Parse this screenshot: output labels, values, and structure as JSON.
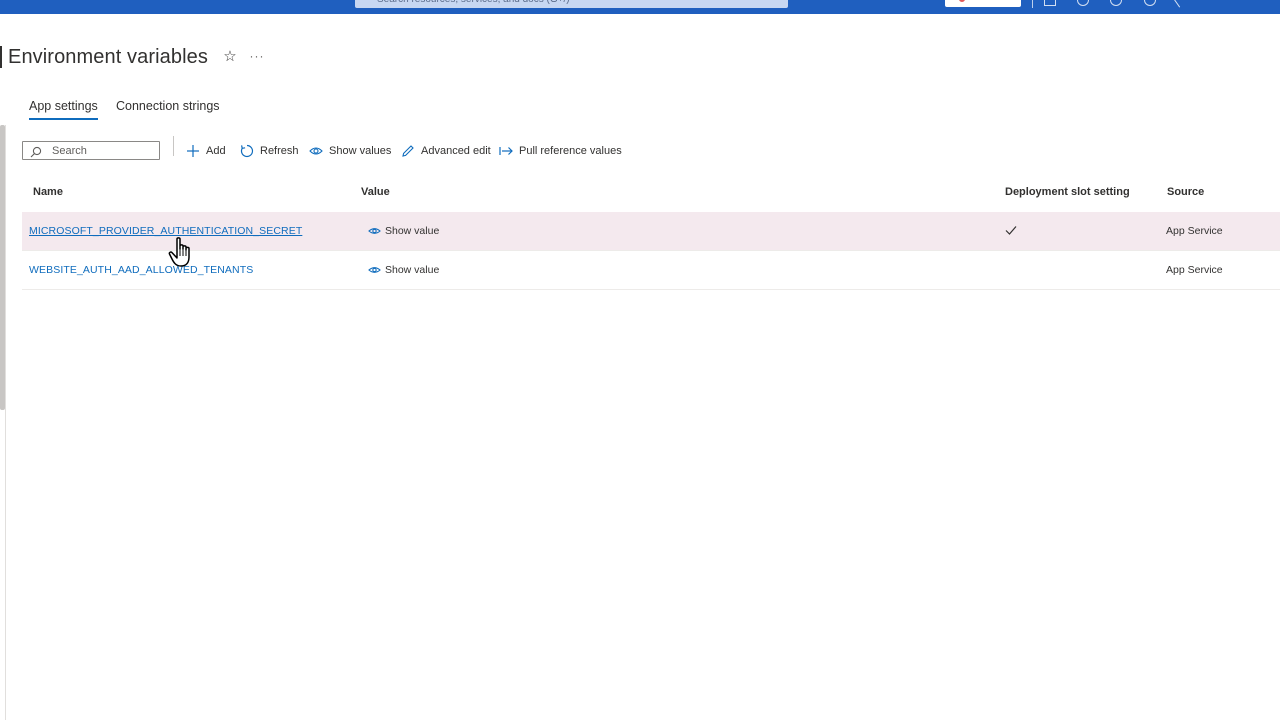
{
  "topbar": {
    "search_placeholder": "Search resources, services, and docs (G+/)"
  },
  "page": {
    "title": "Environment variables"
  },
  "tabs": [
    {
      "label": "App settings",
      "active": true
    },
    {
      "label": "Connection strings",
      "active": false
    }
  ],
  "toolbar": {
    "search_placeholder": "Search",
    "add_label": "Add",
    "refresh_label": "Refresh",
    "show_values_label": "Show values",
    "advanced_edit_label": "Advanced edit",
    "pull_reference_label": "Pull reference values"
  },
  "table": {
    "columns": [
      "Name",
      "Value",
      "Deployment slot setting",
      "Source"
    ],
    "rows": [
      {
        "name": "MICROSOFT_PROVIDER_AUTHENTICATION_SECRET",
        "value_action": "Show value",
        "deployment_slot_setting": true,
        "source": "App Service"
      },
      {
        "name": "WEBSITE_AUTH_AAD_ALLOWED_TENANTS",
        "value_action": "Show value",
        "deployment_slot_setting": false,
        "source": "App Service"
      }
    ]
  },
  "colors": {
    "topbar": "#1f5fbf",
    "accent": "#0f6cbd",
    "row_hover": "#f4e9ee"
  }
}
